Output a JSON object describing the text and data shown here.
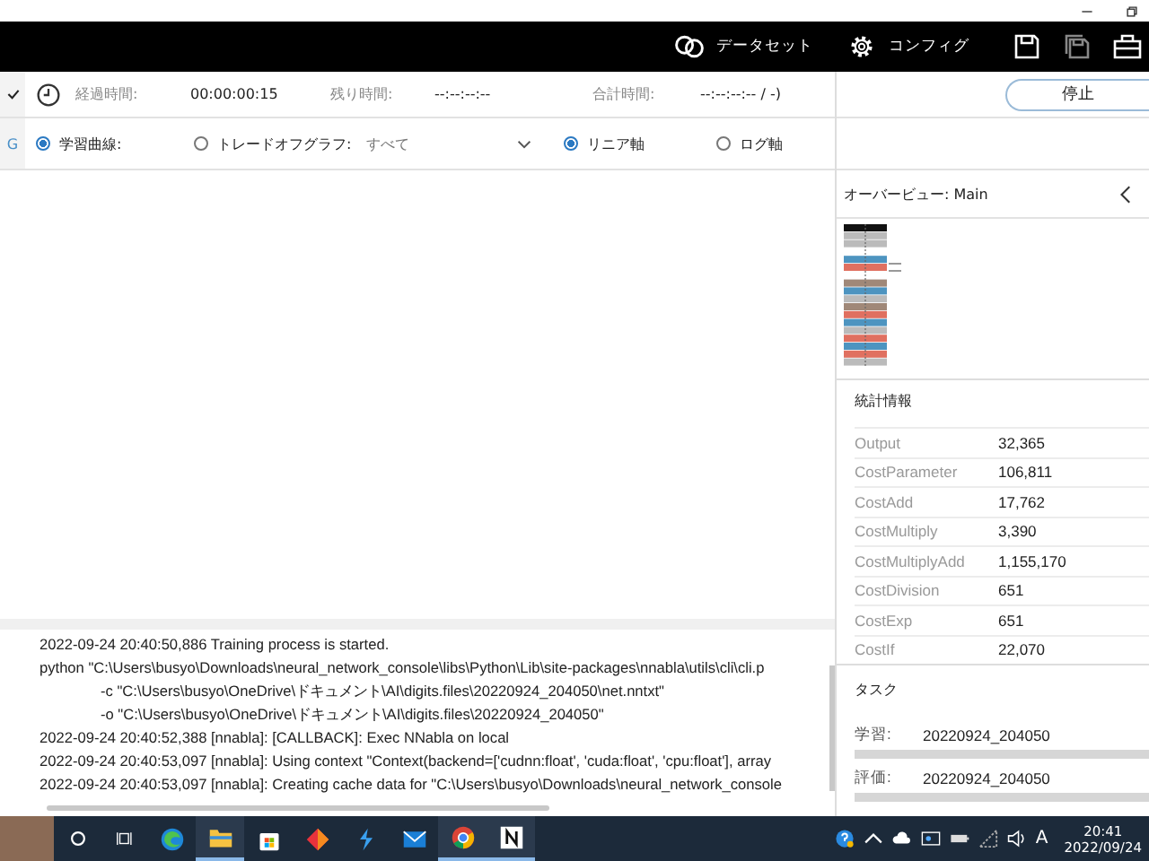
{
  "toolbar": {
    "items": [
      {
        "label": "データセット",
        "kind": "dataset"
      },
      {
        "label": "コンフィグ",
        "kind": "config"
      }
    ]
  },
  "sidebar_fragment": {
    "label": "G"
  },
  "timing": {
    "elapsed_label": "経過時間:",
    "elapsed": "00:00:00:15",
    "remaining_label": "残り時間:",
    "remaining": "--:--:--:--",
    "total_label": "合計時間:",
    "total": "--:--:--:-- / -)"
  },
  "graph_options": [
    {
      "label": "学習曲線:",
      "selected": true
    },
    {
      "label": "トレードオフグラフ:",
      "selected": false
    }
  ],
  "filter": {
    "value": "すべて"
  },
  "axis_options": [
    {
      "label": "リニア軸",
      "selected": true
    },
    {
      "label": "ログ軸",
      "selected": false
    }
  ],
  "log": [
    {
      "text": "2022-09-24 20:40:50,886 Training process is started.",
      "indent": false
    },
    {
      "text": "python \"C:\\Users\\busyo\\Downloads\\neural_network_console\\libs\\Python\\Lib\\site-packages\\nnabla\\utils\\cli\\cli.p",
      "indent": false
    },
    {
      "text": "-c \"C:\\Users\\busyo\\OneDrive\\ドキュメント\\AI\\digits.files\\20220924_204050\\net.nntxt\"",
      "indent": true
    },
    {
      "text": "-o \"C:\\Users\\busyo\\OneDrive\\ドキュメント\\AI\\digits.files\\20220924_204050\"",
      "indent": true
    },
    {
      "text": "2022-09-24 20:40:52,388 [nnabla]: [CALLBACK]: Exec NNabla on local",
      "indent": false
    },
    {
      "text": "2022-09-24 20:40:53,097 [nnabla]: Using context \"Context(backend=['cudnn:float', 'cuda:float', 'cpu:float'], array",
      "indent": false
    },
    {
      "text": "2022-09-24 20:40:53,097 [nnabla]: Creating cache data for \"C:\\Users\\busyo\\Downloads\\neural_network_console",
      "indent": false
    }
  ],
  "stop_button": {
    "label": "停止"
  },
  "overview": {
    "title": "オーバービュー: Main"
  },
  "statistics": {
    "title": "統計情報",
    "rows": [
      {
        "name": "Output",
        "value": "32,365"
      },
      {
        "name": "CostParameter",
        "value": "106,811"
      },
      {
        "name": "CostAdd",
        "value": "17,762"
      },
      {
        "name": "CostMultiply",
        "value": "3,390"
      },
      {
        "name": "CostMultiplyAdd",
        "value": "1,155,170"
      },
      {
        "name": "CostDivision",
        "value": "651"
      },
      {
        "name": "CostExp",
        "value": "651"
      },
      {
        "name": "CostIf",
        "value": "22,070"
      }
    ]
  },
  "tasks": {
    "title": "タスク",
    "items": [
      {
        "label": "学習:",
        "name": "20220924_204050",
        "level": 0
      },
      {
        "label": "評価:",
        "name": "20220924_204050",
        "level": 0
      }
    ]
  },
  "taskbar": {
    "apps": [
      {
        "kind": "edge",
        "active": false
      },
      {
        "kind": "folder",
        "active": true
      },
      {
        "kind": "store",
        "active": false
      },
      {
        "kind": "diamond",
        "active": false
      },
      {
        "kind": "bolt",
        "active": false
      },
      {
        "kind": "mail",
        "active": false
      },
      {
        "kind": "chrome",
        "active": true
      },
      {
        "kind": "n",
        "active": true
      }
    ],
    "ime": "A",
    "time": "20:41",
    "date": "2022/09/24"
  }
}
